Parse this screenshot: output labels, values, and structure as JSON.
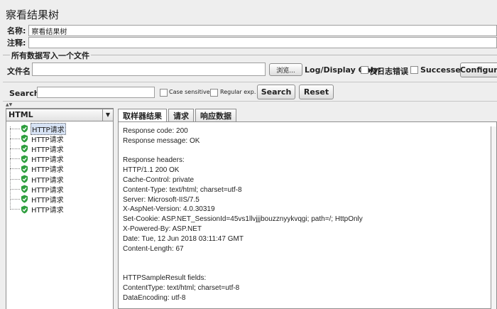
{
  "title": "察看结果树",
  "name_label": "名称:",
  "name_value": "察看结果树",
  "comment_label": "注释:",
  "comment_value": "",
  "file_group": {
    "legend": "所有数据写入一个文件",
    "filename_label": "文件名",
    "filename_value": "",
    "browse_label": "浏览...",
    "log_display_label": "Log/Display Only:",
    "errors_label": "仅日志错误",
    "successes_label": "Successes",
    "configure_label": "Configure"
  },
  "search": {
    "label": "Search:",
    "value": "",
    "case_sensitive_label": "Case sensitive",
    "regex_label": "Regular exp.",
    "search_button": "Search",
    "reset_button": "Reset"
  },
  "renderer": {
    "selected": "HTML"
  },
  "tree": {
    "items": [
      "HTTP请求",
      "HTTP请求",
      "HTTP请求",
      "HTTP请求",
      "HTTP请求",
      "HTTP请求",
      "HTTP请求",
      "HTTP请求",
      "HTTP请求"
    ],
    "selected_index": 0,
    "status_color": "#2e9e3e"
  },
  "tabs": [
    "取样器结果",
    "请求",
    "响应数据"
  ],
  "active_tab": 0,
  "response_lines": [
    "Response code: 200",
    "Response message: OK",
    "",
    "Response headers:",
    "HTTP/1.1 200 OK",
    "Cache-Control: private",
    "Content-Type: text/html; charset=utf-8",
    "Server: Microsoft-IIS/7.5",
    "X-AspNet-Version: 4.0.30319",
    "Set-Cookie: ASP.NET_SessionId=45vs1llvjjjbouzznyykvqgi; path=/; HttpOnly",
    "X-Powered-By: ASP.NET",
    "Date: Tue, 12 Jun 2018 03:11:47 GMT",
    "Content-Length: 67",
    "",
    "",
    "HTTPSampleResult fields:",
    "ContentType: text/html; charset=utf-8",
    "DataEncoding: utf-8"
  ]
}
